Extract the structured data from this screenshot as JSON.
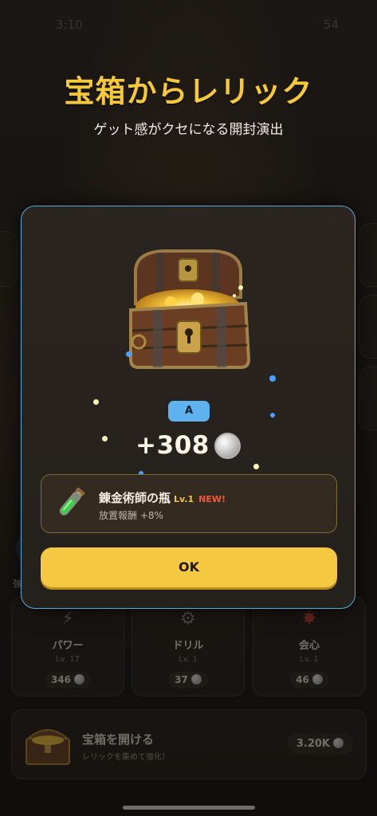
{
  "status_bar": {
    "time": "3:10",
    "battery": "54"
  },
  "headline": "宝箱からレリック",
  "subline": "ゲット感がクセになる開封演出",
  "background": {
    "hint_label": "強",
    "upgrades": [
      {
        "name": "パワー",
        "level": "Lv. 17",
        "cost": "346",
        "icon": "lightning-icon"
      },
      {
        "name": "ドリル",
        "level": "Lv. 1",
        "cost": "37",
        "icon": "gear-icon"
      },
      {
        "name": "会心",
        "level": "Lv. 1",
        "cost": "46",
        "icon": "crit-burst-icon"
      }
    ],
    "open_chest": {
      "title": "宝箱を開ける",
      "description": "レリックを集めて強化！",
      "price": "3.20K"
    }
  },
  "modal": {
    "rarity": "A",
    "reward_amount": "+308",
    "relic": {
      "name": "錬金術師の瓶",
      "level": "Lv.1",
      "new_badge": "NEW!",
      "effect": "放置報酬 +8%"
    },
    "ok_label": "OK"
  },
  "colors": {
    "accent_gold": "#f5c842",
    "modal_border": "#5aa9d8",
    "rarity_badge": "#5eb2f0",
    "new_badge": "#f05a3a"
  }
}
